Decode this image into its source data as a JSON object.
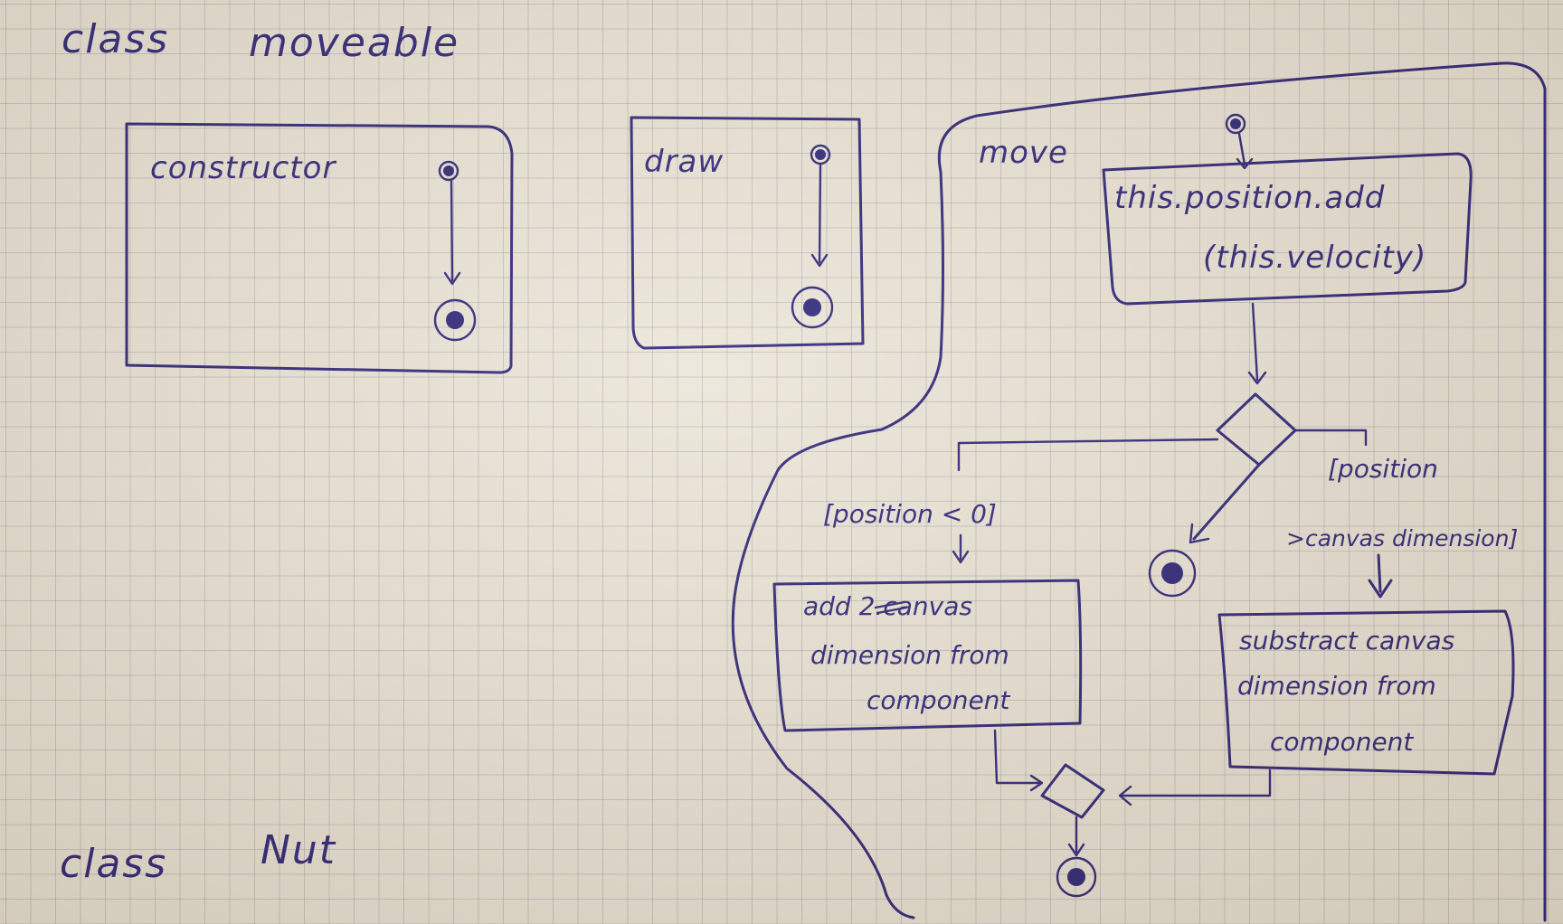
{
  "headings": {
    "class_moveable_keyword": "class",
    "class_moveable_name": "moveable",
    "class_nut_keyword": "class",
    "class_nut_name": "Nut"
  },
  "activities": {
    "constructor": {
      "title": "constructor"
    },
    "draw": {
      "title": "draw"
    },
    "move": {
      "title": "move",
      "action_add": [
        "this.position.add",
        "(this.velocity)"
      ],
      "guard_left": "[position < 0]",
      "guard_right": [
        "[position",
        ">canvas dimension]"
      ],
      "action_left": [
        "add 2.canvas",
        "dimension from",
        "component"
      ],
      "action_left_struck": "can",
      "action_right": [
        "substract canvas",
        "dimension from",
        "component"
      ]
    }
  }
}
